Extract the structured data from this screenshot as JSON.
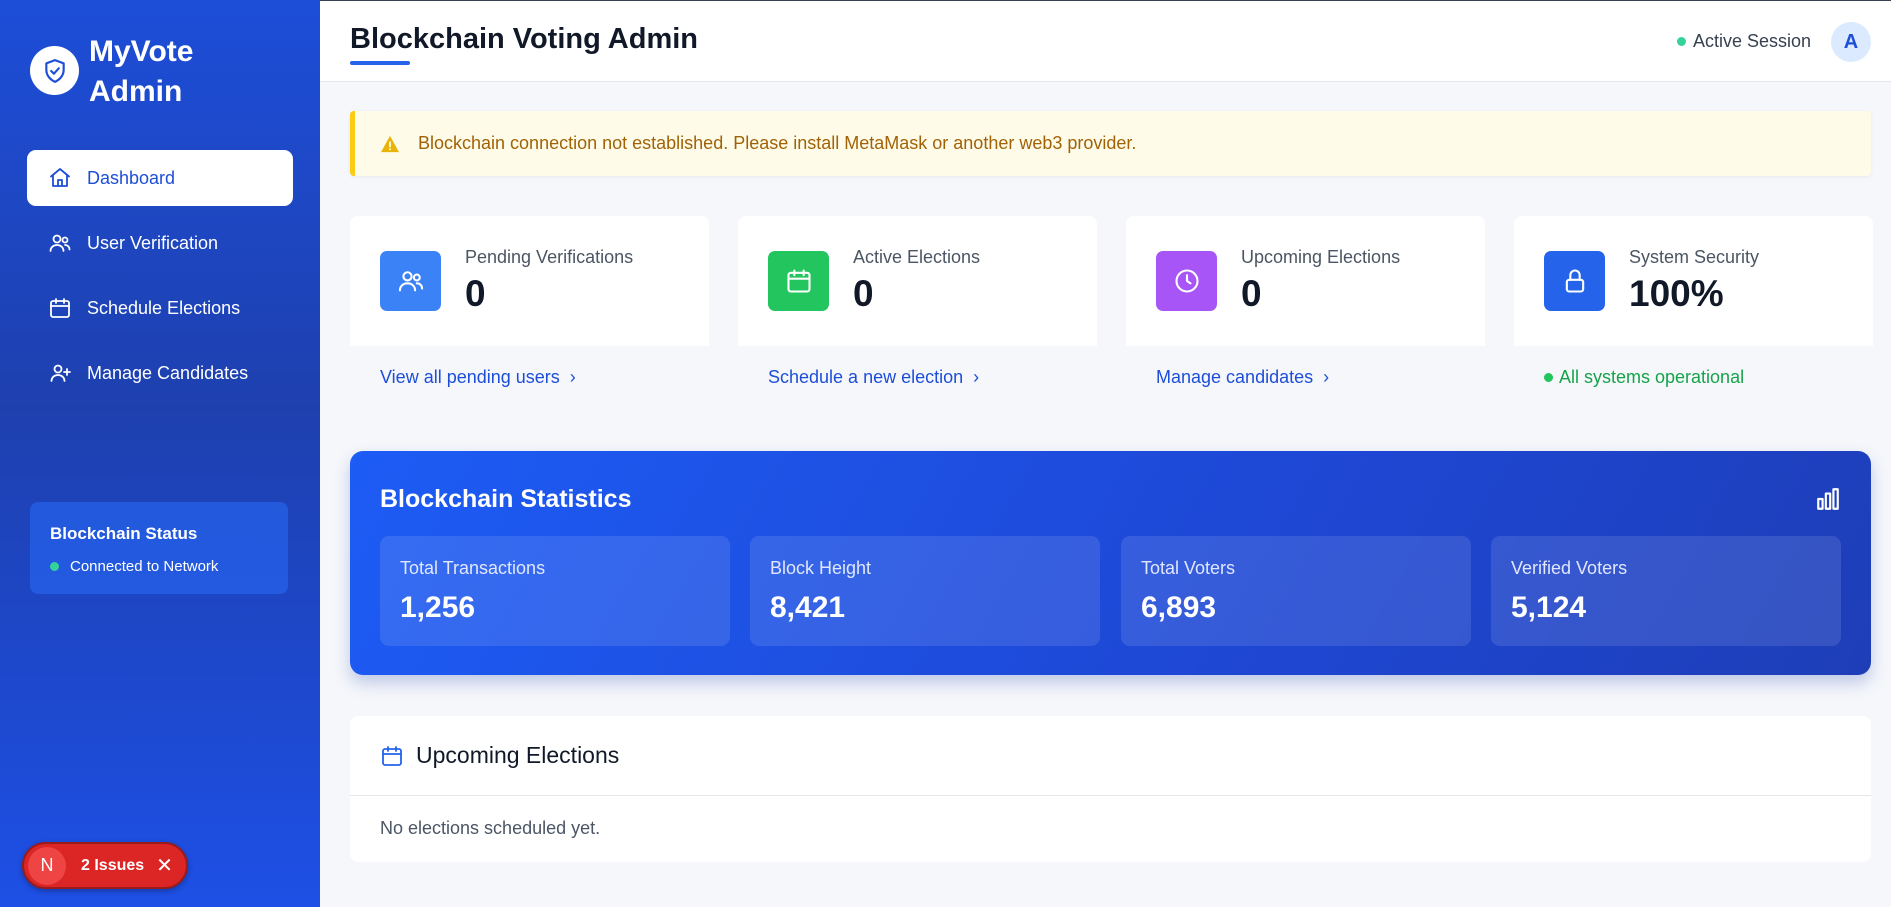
{
  "brand": {
    "title": "MyVote Admin",
    "logo_icon": "shield-check-icon"
  },
  "sidebar": {
    "items": [
      {
        "label": "Dashboard",
        "icon": "home-icon",
        "active": true
      },
      {
        "label": "User Verification",
        "icon": "users-icon",
        "active": false
      },
      {
        "label": "Schedule Elections",
        "icon": "calendar-icon",
        "active": false
      },
      {
        "label": "Manage Candidates",
        "icon": "user-plus-icon",
        "active": false
      }
    ],
    "status": {
      "title": "Blockchain Status",
      "text": "Connected to Network"
    }
  },
  "issues": {
    "badge": "N",
    "label": "2 Issues"
  },
  "header": {
    "title": "Blockchain Voting Admin",
    "session": "Active Session",
    "avatar": "A"
  },
  "alert": {
    "text": "Blockchain connection not established. Please install MetaMask or another web3 provider."
  },
  "stats": [
    {
      "label": "Pending Verifications",
      "value": "0",
      "link": "View all pending users",
      "color": "#3b82f6",
      "icon": "users-icon"
    },
    {
      "label": "Active Elections",
      "value": "0",
      "link": "Schedule a new election",
      "color": "#22c55e",
      "icon": "calendar-icon"
    },
    {
      "label": "Upcoming Elections",
      "value": "0",
      "link": "Manage candidates",
      "color": "#a855f7",
      "icon": "clock-icon"
    },
    {
      "label": "System Security",
      "value": "100%",
      "link": "All systems operational",
      "color": "#2563eb",
      "icon": "lock-icon"
    }
  ],
  "blockchain_stats": {
    "title": "Blockchain Statistics",
    "items": [
      {
        "label": "Total Transactions",
        "value": "1,256"
      },
      {
        "label": "Block Height",
        "value": "8,421"
      },
      {
        "label": "Total Voters",
        "value": "6,893"
      },
      {
        "label": "Verified Voters",
        "value": "5,124"
      }
    ]
  },
  "upcoming": {
    "title": "Upcoming Elections",
    "empty": "No elections scheduled yet."
  }
}
